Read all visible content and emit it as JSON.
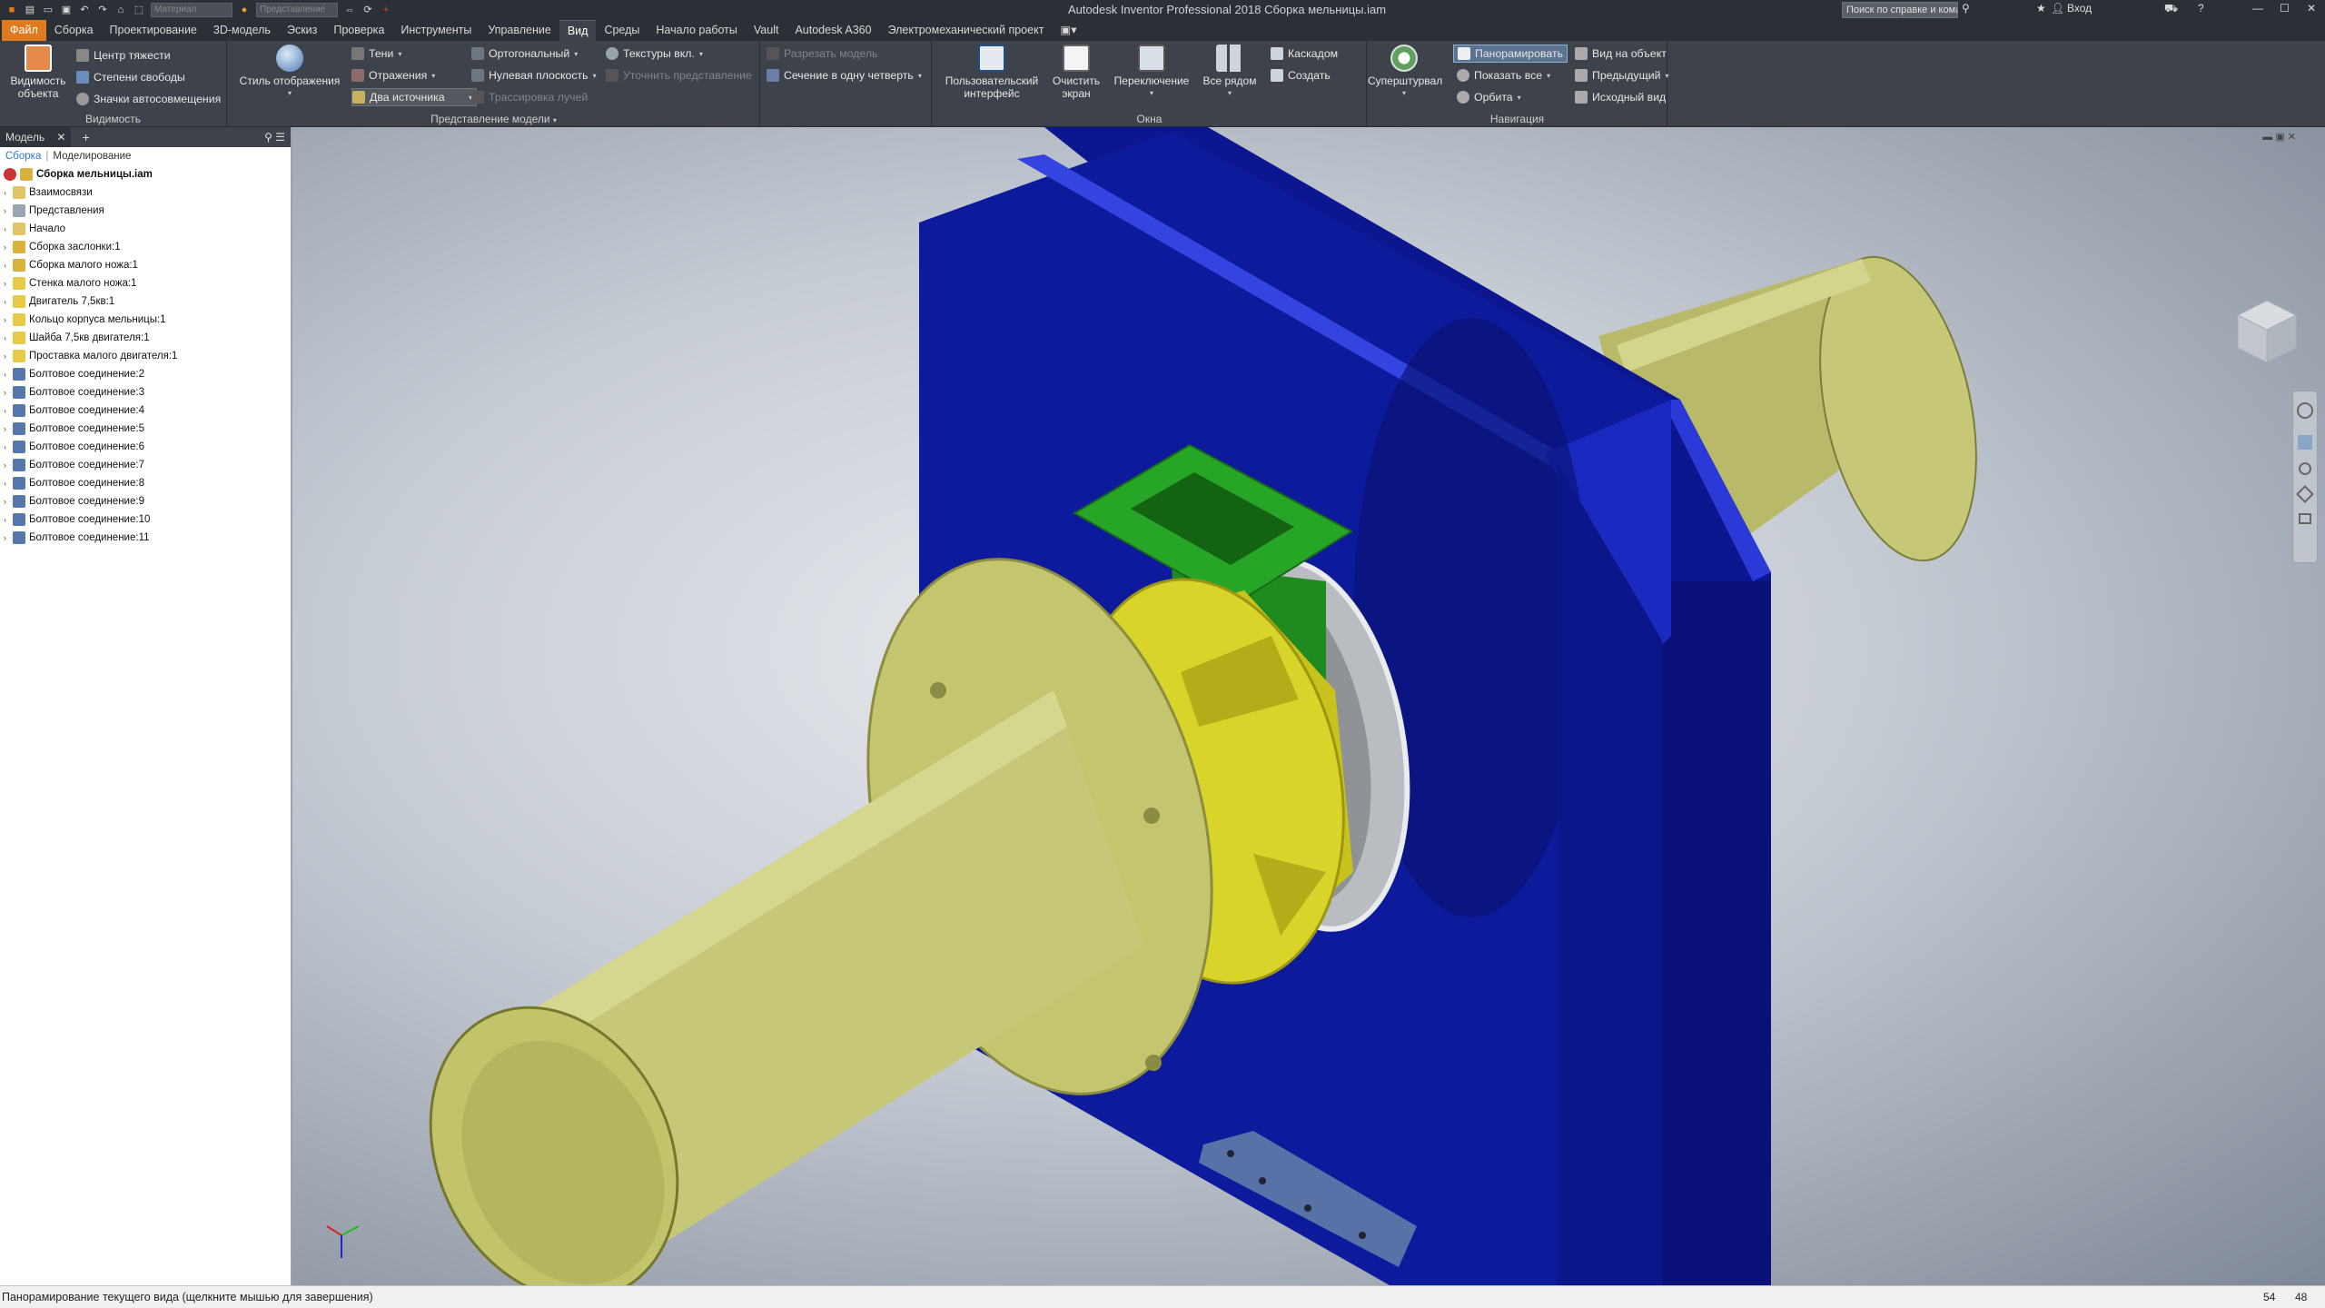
{
  "titlebar": {
    "app_title": "Autodesk Inventor Professional 2018    Сборка мельницы.iam",
    "search_placeholder": "Поиск по справке и командам",
    "signin": "Вход",
    "material_combo": "Материал",
    "appearance_combo": "Представление"
  },
  "menu": {
    "tabs": [
      "Файл",
      "Сборка",
      "Проектирование",
      "3D-модель",
      "Эскиз",
      "Проверка",
      "Инструменты",
      "Управление",
      "Вид",
      "Среды",
      "Начало работы",
      "Vault",
      "Autodesk A360",
      "Электромеханический проект"
    ],
    "active": "Вид"
  },
  "ribbon": {
    "visibility": {
      "title": "Видимость",
      "big_label_1": "Видимость",
      "big_label_2": "объекта",
      "items": [
        "Центр тяжести",
        "Степени свободы",
        "Значки автосовмещения"
      ]
    },
    "model_view": {
      "title": "Представление модели",
      "style_label": "Стиль отображения",
      "col1": [
        "Тени",
        "Отражения",
        "Два источника"
      ],
      "col2": [
        "Ортогональный",
        "Нулевая плоскость",
        "Трассировка лучей"
      ],
      "col3": [
        "Текстуры вкл.",
        "Уточнить представление"
      ],
      "col4": [
        "Разрезать модель",
        "Сечение в одну четверть"
      ]
    },
    "windows": {
      "title": "Окна",
      "ui_label_1": "Пользовательский",
      "ui_label_2": "интерфейс",
      "clean_label_1": "Очистить",
      "clean_label_2": "экран",
      "switch_label": "Переключение",
      "tile_label": "Все рядом",
      "items": [
        "Каскадом",
        "Создать"
      ]
    },
    "navigation": {
      "title": "Навигация",
      "wheel_label": "Суперштурвал",
      "col1": [
        "Панорамировать",
        "Показать все",
        "Орбита"
      ],
      "col2": [
        "Вид на объект",
        "Предыдущий",
        "Исходный вид"
      ]
    }
  },
  "browser": {
    "tab": "Модель",
    "subtabs": [
      "Сборка",
      "Моделирование"
    ],
    "root": "Сборка мельницы.iam",
    "items": [
      "Взаимосвязи",
      "Представления",
      "Начало",
      "Сборка заслонки:1",
      "Сборка малого ножа:1",
      "Стенка малого ножа:1",
      "Двигатель 7,5кв:1",
      "Кольцо корпуса мельницы:1",
      "Шайба 7,5кв двигателя:1",
      "Проставка малого двигателя:1",
      "Болтовое соединение:2",
      "Болтовое соединение:3",
      "Болтовое соединение:4",
      "Болтовое соединение:5",
      "Болтовое соединение:6",
      "Болтовое соединение:7",
      "Болтовое соединение:8",
      "Болтовое соединение:9",
      "Болтовое соединение:10",
      "Болтовое соединение:11"
    ]
  },
  "status": {
    "text": "Панорамирование текущего вида (щелкните мышью для завершения)",
    "n1": "54",
    "n2": "48"
  },
  "colors": {
    "plate": "#0d1a9c",
    "motor": "#c6c877",
    "ring": "#d8d42a",
    "hopper": "#1f9a1f",
    "washer": "#b9bcc0",
    "accent": "#e07a1f"
  }
}
